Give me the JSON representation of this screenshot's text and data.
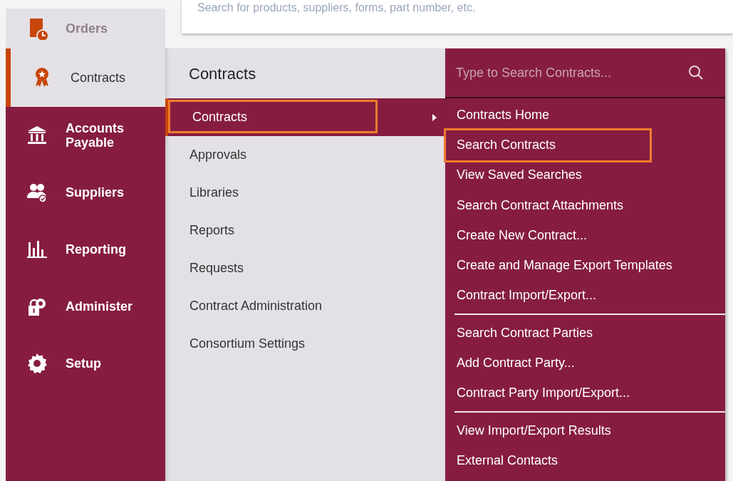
{
  "top_search": {
    "placeholder": "Search for products, suppliers, forms, part number, etc."
  },
  "sidebar": {
    "items": [
      {
        "label": "Orders",
        "selected": false,
        "faded": true
      },
      {
        "label": "Contracts",
        "selected": true,
        "faded": false
      },
      {
        "label": "Accounts Payable",
        "selected": false,
        "faded": false
      },
      {
        "label": "Suppliers",
        "selected": false,
        "faded": false
      },
      {
        "label": "Reporting",
        "selected": false,
        "faded": false
      },
      {
        "label": "Administer",
        "selected": false,
        "faded": false
      },
      {
        "label": "Setup",
        "selected": false,
        "faded": false
      }
    ]
  },
  "submenu": {
    "title": "Contracts",
    "items": [
      {
        "label": "Contracts",
        "selected": true,
        "highlighted": true,
        "has_submenu": true
      },
      {
        "label": "Approvals",
        "selected": false,
        "highlighted": false,
        "has_submenu": false
      },
      {
        "label": "Libraries",
        "selected": false,
        "highlighted": false,
        "has_submenu": false
      },
      {
        "label": "Reports",
        "selected": false,
        "highlighted": false,
        "has_submenu": false
      },
      {
        "label": "Requests",
        "selected": false,
        "highlighted": false,
        "has_submenu": false
      },
      {
        "label": "Contract Administration",
        "selected": false,
        "highlighted": false,
        "has_submenu": false
      },
      {
        "label": "Consortium Settings",
        "selected": false,
        "highlighted": false,
        "has_submenu": false
      }
    ]
  },
  "flyout": {
    "search": {
      "placeholder": "Type to Search Contracts..."
    },
    "groups": [
      [
        {
          "label": "Contracts Home",
          "highlighted": false
        },
        {
          "label": "Search Contracts",
          "highlighted": true
        },
        {
          "label": "View Saved Searches",
          "highlighted": false
        },
        {
          "label": "Search Contract Attachments",
          "highlighted": false
        },
        {
          "label": "Create New Contract...",
          "highlighted": false
        },
        {
          "label": "Create and Manage Export Templates",
          "highlighted": false
        },
        {
          "label": "Contract Import/Export...",
          "highlighted": false
        }
      ],
      [
        {
          "label": "Search Contract Parties",
          "highlighted": false
        },
        {
          "label": "Add Contract Party...",
          "highlighted": false
        },
        {
          "label": "Contract Party Import/Export...",
          "highlighted": false
        }
      ],
      [
        {
          "label": "View Import/Export Results",
          "highlighted": false
        },
        {
          "label": "External Contacts",
          "highlighted": false
        }
      ]
    ]
  }
}
